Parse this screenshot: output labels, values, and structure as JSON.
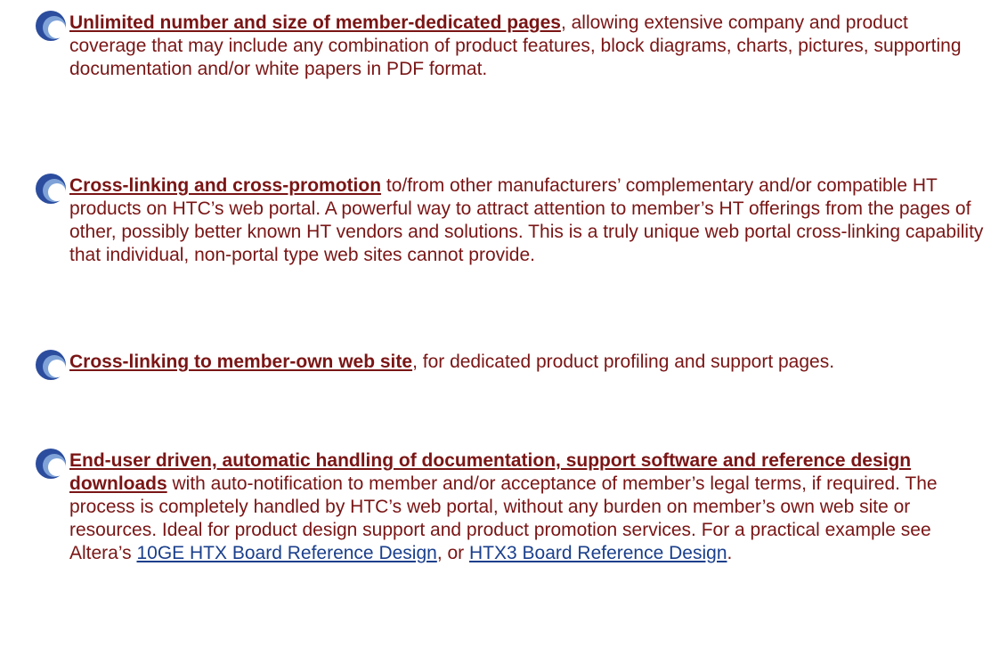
{
  "icon_name": "crescent-bullet-icon",
  "colors": {
    "text": "#7a1515",
    "link": "#1a3f8c",
    "icon_outer": "#2c4d9e",
    "icon_inner": "#7fa3d8"
  },
  "bullets": [
    {
      "lead": "Unlimited number and size of member-dedicated pages",
      "body": ", allowing extensive company and product coverage that may include any combination of product features, block diagrams, charts, pictures, supporting documentation and/or white papers in PDF format."
    },
    {
      "lead": "Cross-linking and cross-promotion",
      "body": " to/from other manufacturers’ complementary and/or compatible HT products on HTC’s web portal.  A powerful way to attract attention to member’s HT offerings from the pages of other, possibly better known HT vendors and solutions. This is a truly unique web portal cross-linking capability that individual, non-portal type web sites cannot provide."
    },
    {
      "lead": "Cross-linking to member-own web site",
      "body": ", for dedicated product profiling and support pages."
    },
    {
      "lead": "End-user driven, automatic handling of documentation, support software and reference design downloads",
      "body": " with auto-notification to member and/or acceptance of member’s legal terms, if required. The process is completely handled by HTC’s web portal, without any burden on member’s own web site or resources.  Ideal for product design support and product promotion services. For a practical example see Altera’s ",
      "link1": "10GE HTX Board Reference Design",
      "between": ", or ",
      "link2": "HTX3 Board Reference Design",
      "end": "."
    }
  ]
}
